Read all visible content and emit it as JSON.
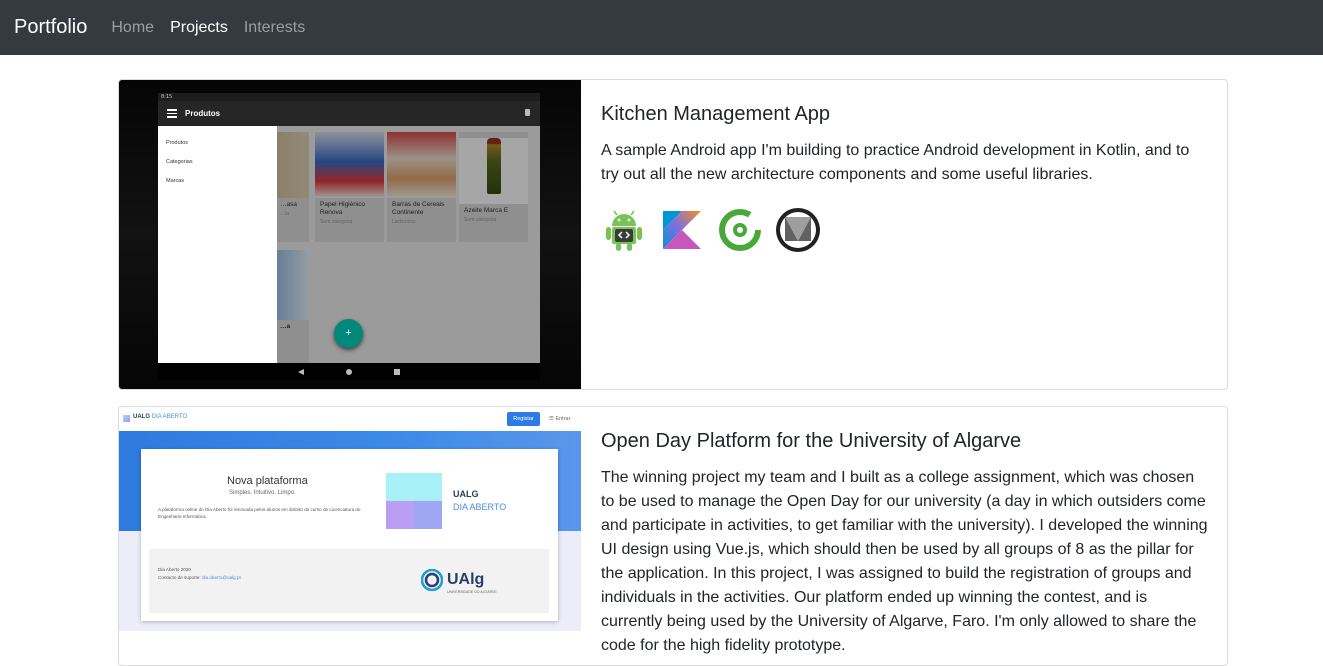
{
  "navbar": {
    "brand": "Portfolio",
    "links": [
      {
        "label": "Home",
        "active": false
      },
      {
        "label": "Projects",
        "active": true
      },
      {
        "label": "Interests",
        "active": false
      }
    ]
  },
  "projects": [
    {
      "title": "Kitchen Management App",
      "description": "A sample Android app I'm building to practice Android development in Kotlin, and to try out all the new architecture components and some useful libraries.",
      "technologies": [
        "android-icon",
        "kotlin-icon",
        "circleci-icon",
        "material-icon"
      ],
      "screenshot": {
        "status_time": "8:15",
        "app_title": "Produtos",
        "drawer_items": [
          "Produtos",
          "Categorias",
          "Marcas"
        ],
        "products": [
          {
            "name": "…asa",
            "category": "…ia"
          },
          {
            "name": "Papel Higiénico Renova",
            "category": "Sem categoria"
          },
          {
            "name": "Barras de Cereais Continente",
            "category": "Lacticínios"
          },
          {
            "name": "Azeite Marca E",
            "category": "Sem categoria"
          }
        ],
        "fab": "+",
        "partial_label": "…a"
      }
    },
    {
      "title": "Open Day Platform for the University of Algarve",
      "description": "The winning project my team and I built as a college assignment, which was chosen to be used to manage the Open Day for our university (a day in which outsiders come and participate in activities, to get familiar with the university). I developed the winning UI design using Vue.js, which should then be used by all groups of 8 as the pillar for the application. In this project, I was assigned to build the registration of groups and individuals in the activities. Our platform ended up winning the contest, and is currently being used by the University of Algarve, Faro. I'm only allowed to share the code for the high fidelity prototype.",
      "screenshot": {
        "site_name": "UALG",
        "site_name_accent": "DIA ABERTO",
        "register_button": "Registar",
        "login_button": "☰ Entrar",
        "heading": "Nova plataforma",
        "subheading": "Simples. Intuitivo. Limpo.",
        "paragraph": "A plataforma online do Dia Aberto foi renovada pelos alunos em âmbito do curso de Licenciatura de Engenharia Informática.",
        "logo_line1": "UALG",
        "logo_line2": "DIA ABERTO",
        "footer_line1": "Dia Aberto 2020",
        "footer_line2": "Contacto de suporte:",
        "footer_email": "dia.aberto@ualg.pt",
        "ualg_logo": "UAlg",
        "ualg_logo_sub": "UNIVERSIDADE DO ALGARVE"
      }
    }
  ]
}
